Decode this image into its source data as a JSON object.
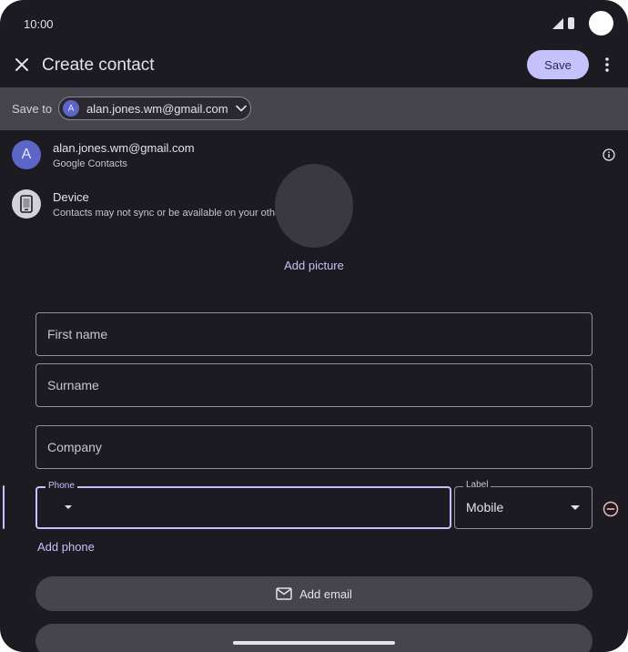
{
  "status_bar": {
    "time": "10:00"
  },
  "app_bar": {
    "title": "Create contact",
    "save_label": "Save"
  },
  "save_to": {
    "label": "Save to",
    "account_initial": "A",
    "account": "alan.jones.wm@gmail.com"
  },
  "account_menu": {
    "options": [
      {
        "initial": "A",
        "title": "alan.jones.wm@gmail.com",
        "subtitle": "Google Contacts"
      },
      {
        "title": "Device",
        "subtitle": "Contacts may not sync or be available on your other devices"
      }
    ]
  },
  "picture": {
    "add_label": "Add picture"
  },
  "form": {
    "first_name_placeholder": "First name",
    "surname_placeholder": "Surname",
    "company_placeholder": "Company",
    "phone_label": "Phone",
    "phone_value": "",
    "type_label": "Label",
    "type_value": "Mobile",
    "add_phone": "Add phone",
    "add_email": "Add email"
  },
  "colors": {
    "accent": "#c5c1fb",
    "surface": "#1c1b21",
    "avatar": "#5c66c9"
  }
}
